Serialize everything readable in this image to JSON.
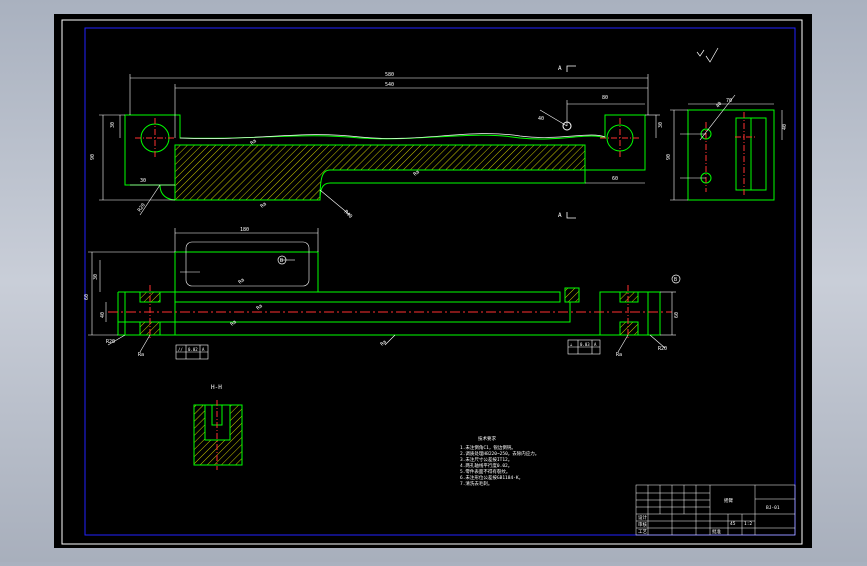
{
  "drawing": {
    "colors": {
      "viewport_bg": "#000000",
      "border": "#ffffff",
      "frame": "#2222ff",
      "outline": "#00ff00",
      "dimension": "#ffffff",
      "centerline": "#ff3030",
      "hatch": "#ffff00",
      "leader": "#00ffff"
    },
    "dims": {
      "overall_length": "580",
      "inner_length": "540",
      "left_height": "90",
      "slot_width": "30",
      "right_offset": "80",
      "pin_dia": "40",
      "radius_a": "R20",
      "radius_b": "R40",
      "end_width": "60",
      "side_width": "70",
      "pocket_length": "180",
      "plan_height": "60",
      "depth": "40"
    },
    "section_labels": {
      "top_left": "A",
      "top_right": "A",
      "section_hh": "H-H"
    },
    "datum": "B",
    "roughness": "Ra",
    "tolerance_left": [
      "//",
      "0.02",
      "A"
    ],
    "tolerance_right": [
      "⊥",
      "0.03",
      "A"
    ],
    "notes": {
      "title": "技术要求",
      "lines": [
        "1.未注倒角C1，锐边倒钝。",
        "2.调质处理HB220~250，去除内应力。",
        "3.未注尺寸公差按IT12。",
        "4.两孔轴线平行度0.02。",
        "5.零件表面不得有裂纹。",
        "6.未注形位公差按GB1184-K。",
        "7.清洗去毛刺。"
      ]
    },
    "title_block": {
      "part_name": "摇臂",
      "drawing_no": "BJ-01",
      "scale": "1:2",
      "material": "45",
      "labels": [
        "设计",
        "审核",
        "工艺",
        "批准"
      ]
    }
  }
}
